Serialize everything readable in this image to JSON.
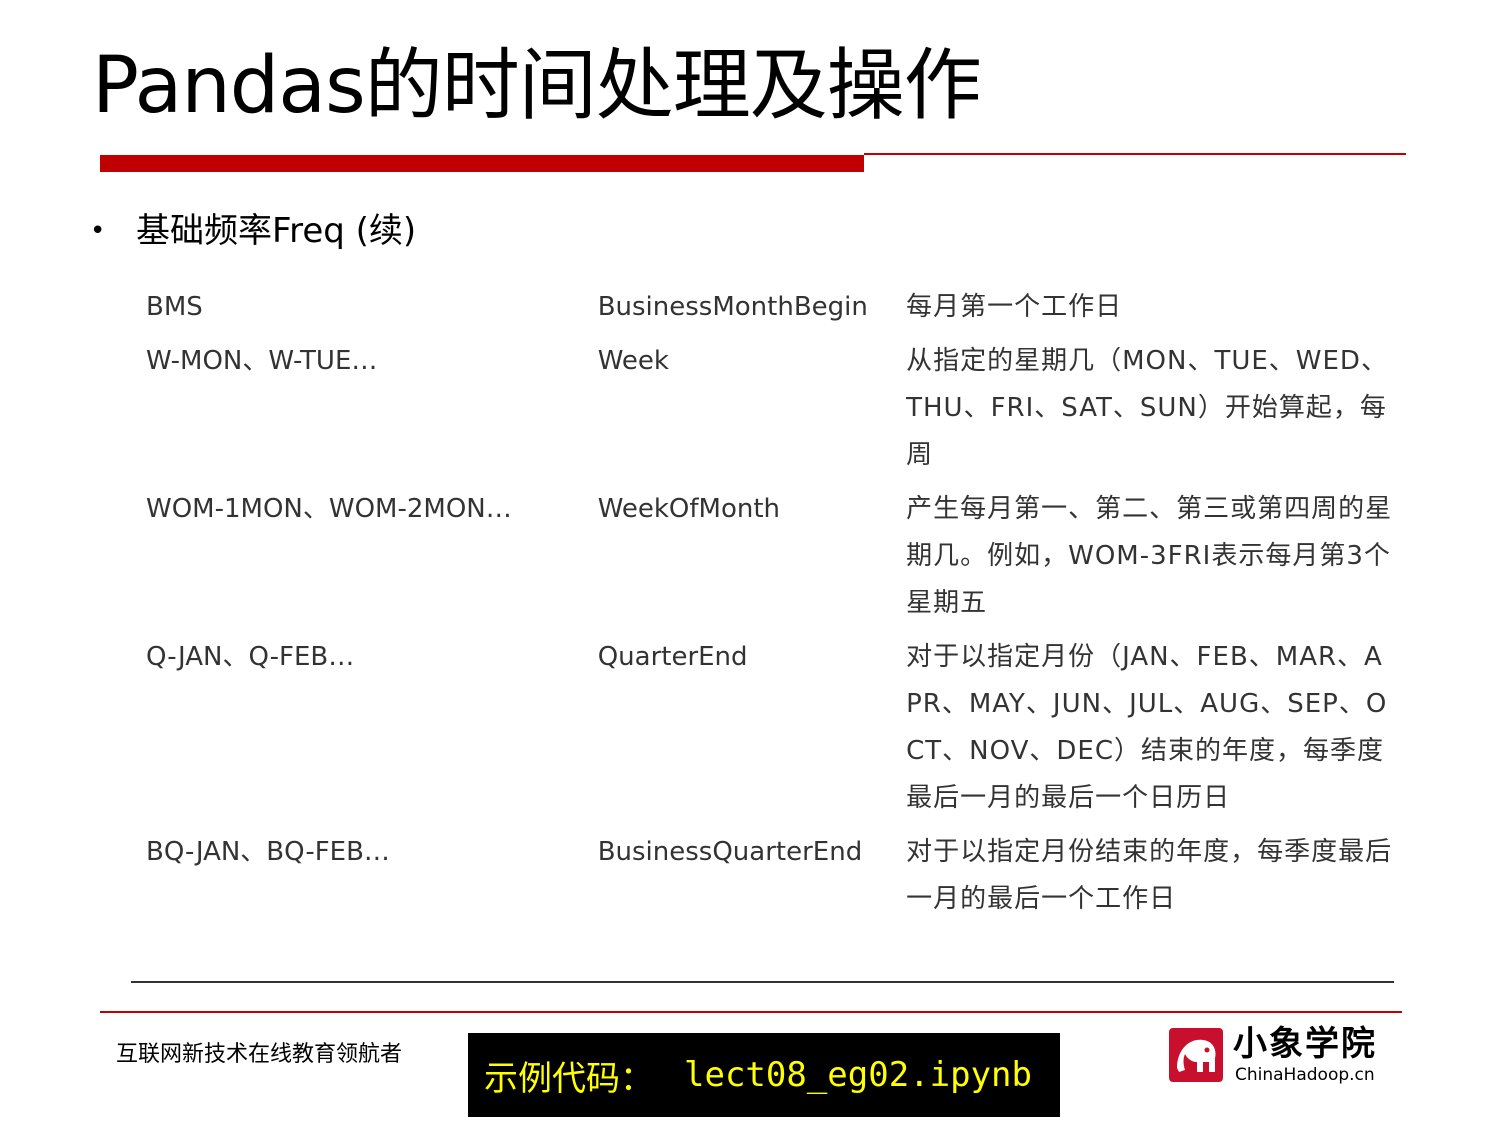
{
  "title": "Pandas的时间处理及操作",
  "bullet": "基础频率Freq (续)",
  "table": {
    "rows": [
      {
        "code": "BMS",
        "name": "BusinessMonthBegin",
        "desc": "每月第一个工作日"
      },
      {
        "code": "W-MON、W-TUE…",
        "name": "Week",
        "desc": "从指定的星期几（MON、TUE、WED、THU、FRI、SAT、SUN）开始算起，每周"
      },
      {
        "code": "WOM-1MON、WOM-2MON…",
        "name": "WeekOfMonth",
        "desc": "产生每月第一、第二、第三或第四周的星期几。例如，WOM-3FRI表示每月第3个星期五"
      },
      {
        "code": "Q-JAN、Q-FEB…",
        "name": "QuarterEnd",
        "desc": "对于以指定月份（JAN、FEB、MAR、APR、MAY、JUN、JUL、AUG、SEP、OCT、NOV、DEC）结束的年度，每季度最后一月的最后一个日历日"
      },
      {
        "code": "BQ-JAN、BQ-FEB…",
        "name": "BusinessQuarterEnd",
        "desc": "对于以指定月份结束的年度，每季度最后一月的最后一个工作日"
      }
    ]
  },
  "footer": {
    "slogan": "互联网新技术在线教育领航者",
    "code_label": "示例代码：",
    "code_file": "lect08_eg02.ipynb"
  },
  "logo": {
    "name": "小象学院",
    "domain": "ChinaHadoop.cn"
  },
  "colors": {
    "accent": "#c00000",
    "code_bg": "#000000",
    "code_text": "#ffff00"
  }
}
